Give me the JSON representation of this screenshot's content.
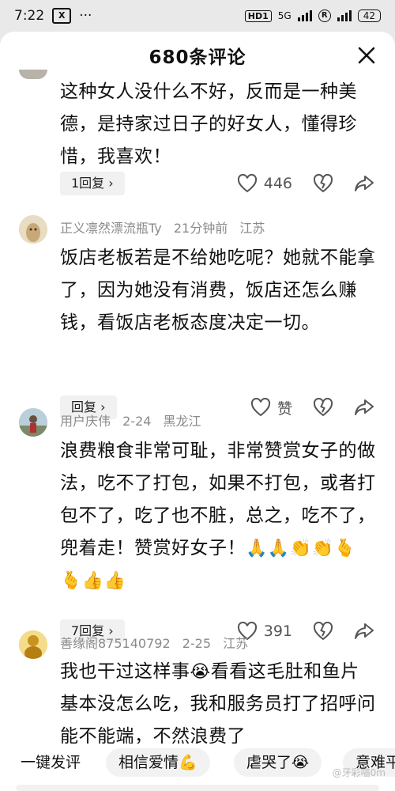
{
  "status_bar": {
    "time": "7:22",
    "app_badge": "X",
    "dots": "···",
    "hd_badge": "HD1",
    "network": "5G",
    "r_badge": "R",
    "battery": "42"
  },
  "sheet": {
    "title": "680条评论"
  },
  "comments": [
    {
      "text": "这种女人没什么不好，反而是一种美德，是持家过日子的好女人，懂得珍惜，我喜欢！",
      "reply_label": "1回复 ›",
      "likes": "446"
    },
    {
      "author": "正义凛然漂流瓶Ty",
      "time": "21分钟前",
      "location": "江苏",
      "text": "饭店老板若是不给她吃呢？她就不能拿了，因为她没有消费，饭店还怎么赚钱，看饭店老板态度决定一切。",
      "reply_label": "回复 ›",
      "likes": "赞"
    },
    {
      "author": "用户庆伟",
      "time": "2-24",
      "location": "黑龙江",
      "text": "浪费粮食非常可耻，非常赞赏女子的做法，吃不了打包，如果不打包，或者打包不了，吃了也不脏，总之，吃不了，兜着走！赞赏好女子！",
      "emojis": "🙏🙏👏👏🫰🫰👍👍",
      "reply_label": "7回复 ›",
      "likes": "391"
    },
    {
      "author": "善缘阁875140792",
      "time": "2-25",
      "location": "江苏",
      "text_a": "我也干过这样事",
      "emoji": "😭",
      "text_b": "看看这毛肚和鱼片基本没怎么吃，我和服务员打了招呼问能不能端，不然浪费了"
    }
  ],
  "bottom_bar": {
    "quick_comment": "一键发评",
    "chips": [
      "相信爱情💪",
      "虐哭了😭",
      "意难平"
    ],
    "watermark": "@牙彩喵0m"
  }
}
